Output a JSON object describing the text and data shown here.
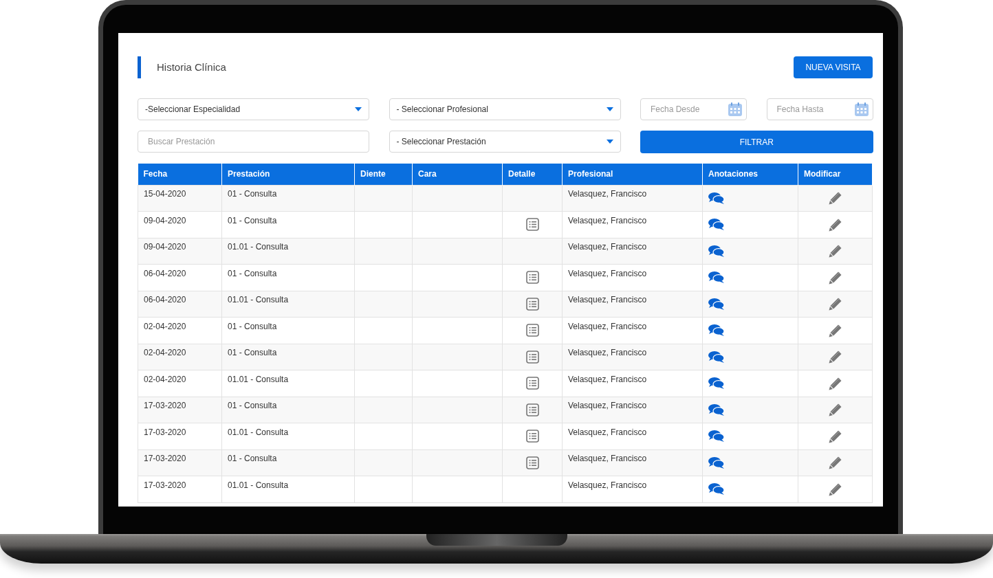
{
  "page": {
    "title": "Historia Clínica"
  },
  "actions": [
    {
      "label": "NUEVA VISITA"
    }
  ],
  "filters": [
    {
      "kind": "select",
      "value": "-Seleccionar Especialidad"
    },
    {
      "kind": "select",
      "value": "- Seleccionar Profesional"
    },
    {
      "kind": "date",
      "placeholder": "Fecha Desde"
    },
    {
      "kind": "date",
      "placeholder": "Fecha Hasta"
    },
    {
      "kind": "text",
      "placeholder": "Buscar Prestación"
    },
    {
      "kind": "select",
      "value": "- Seleccionar Prestación"
    },
    {
      "kind": "button",
      "label": "FILTRAR"
    }
  ],
  "table": {
    "columns": [
      "Fecha",
      "Prestación",
      "Diente",
      "Cara",
      "Detalle",
      "Profesional",
      "Anotaciones",
      "Modificar"
    ],
    "rows": [
      {
        "date": "15-04-2020",
        "service": "01 - Consulta",
        "detail": false,
        "professional": "Velasquez, Francisco"
      },
      {
        "date": "09-04-2020",
        "service": "01 - Consulta",
        "detail": true,
        "professional": "Velasquez, Francisco"
      },
      {
        "date": "09-04-2020",
        "service": "01.01 - Consulta",
        "detail": false,
        "professional": "Velasquez, Francisco"
      },
      {
        "date": "06-04-2020",
        "service": "01 - Consulta",
        "detail": true,
        "professional": "Velasquez, Francisco"
      },
      {
        "date": "06-04-2020",
        "service": "01.01 - Consulta",
        "detail": true,
        "professional": "Velasquez, Francisco"
      },
      {
        "date": "02-04-2020",
        "service": "01 - Consulta",
        "detail": true,
        "professional": "Velasquez, Francisco"
      },
      {
        "date": "02-04-2020",
        "service": "01 - Consulta",
        "detail": true,
        "professional": "Velasquez, Francisco"
      },
      {
        "date": "02-04-2020",
        "service": "01.01 - Consulta",
        "detail": true,
        "professional": "Velasquez, Francisco"
      },
      {
        "date": "17-03-2020",
        "service": "01 - Consulta",
        "detail": true,
        "professional": "Velasquez, Francisco"
      },
      {
        "date": "17-03-2020",
        "service": "01.01 - Consulta",
        "detail": true,
        "professional": "Velasquez, Francisco"
      },
      {
        "date": "17-03-2020",
        "service": "01 - Consulta",
        "detail": true,
        "professional": "Velasquez, Francisco"
      },
      {
        "date": "17-03-2020",
        "service": "01.01 - Consulta",
        "detail": false,
        "professional": "Velasquez, Francisco"
      }
    ]
  }
}
